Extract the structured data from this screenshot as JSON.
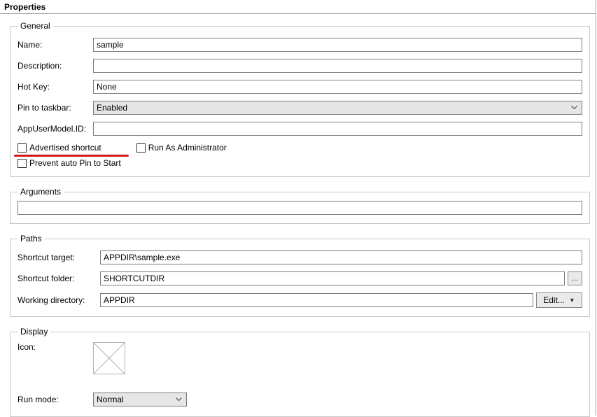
{
  "panel": {
    "title": "Properties"
  },
  "general": {
    "legend": "General",
    "name_label": "Name:",
    "name_value": "sample",
    "description_label": "Description:",
    "description_value": "",
    "hotkey_label": "Hot Key:",
    "hotkey_value": "None",
    "pin_label": "Pin to taskbar:",
    "pin_value": "Enabled",
    "appid_label": "AppUserModel.ID:",
    "appid_value": "",
    "advertised_label": "Advertised shortcut",
    "runas_label": "Run As Administrator",
    "prevent_pin_label": "Prevent auto Pin to Start"
  },
  "arguments": {
    "legend": "Arguments",
    "value": ""
  },
  "paths": {
    "legend": "Paths",
    "target_label": "Shortcut target:",
    "target_value": "APPDIR\\sample.exe",
    "folder_label": "Shortcut folder:",
    "folder_value": "SHORTCUTDIR",
    "workdir_label": "Working directory:",
    "workdir_value": "APPDIR",
    "browse_glyph": "...",
    "edit_label": "Edit..."
  },
  "display": {
    "legend": "Display",
    "icon_label": "Icon:",
    "runmode_label": "Run mode:",
    "runmode_value": "Normal"
  }
}
